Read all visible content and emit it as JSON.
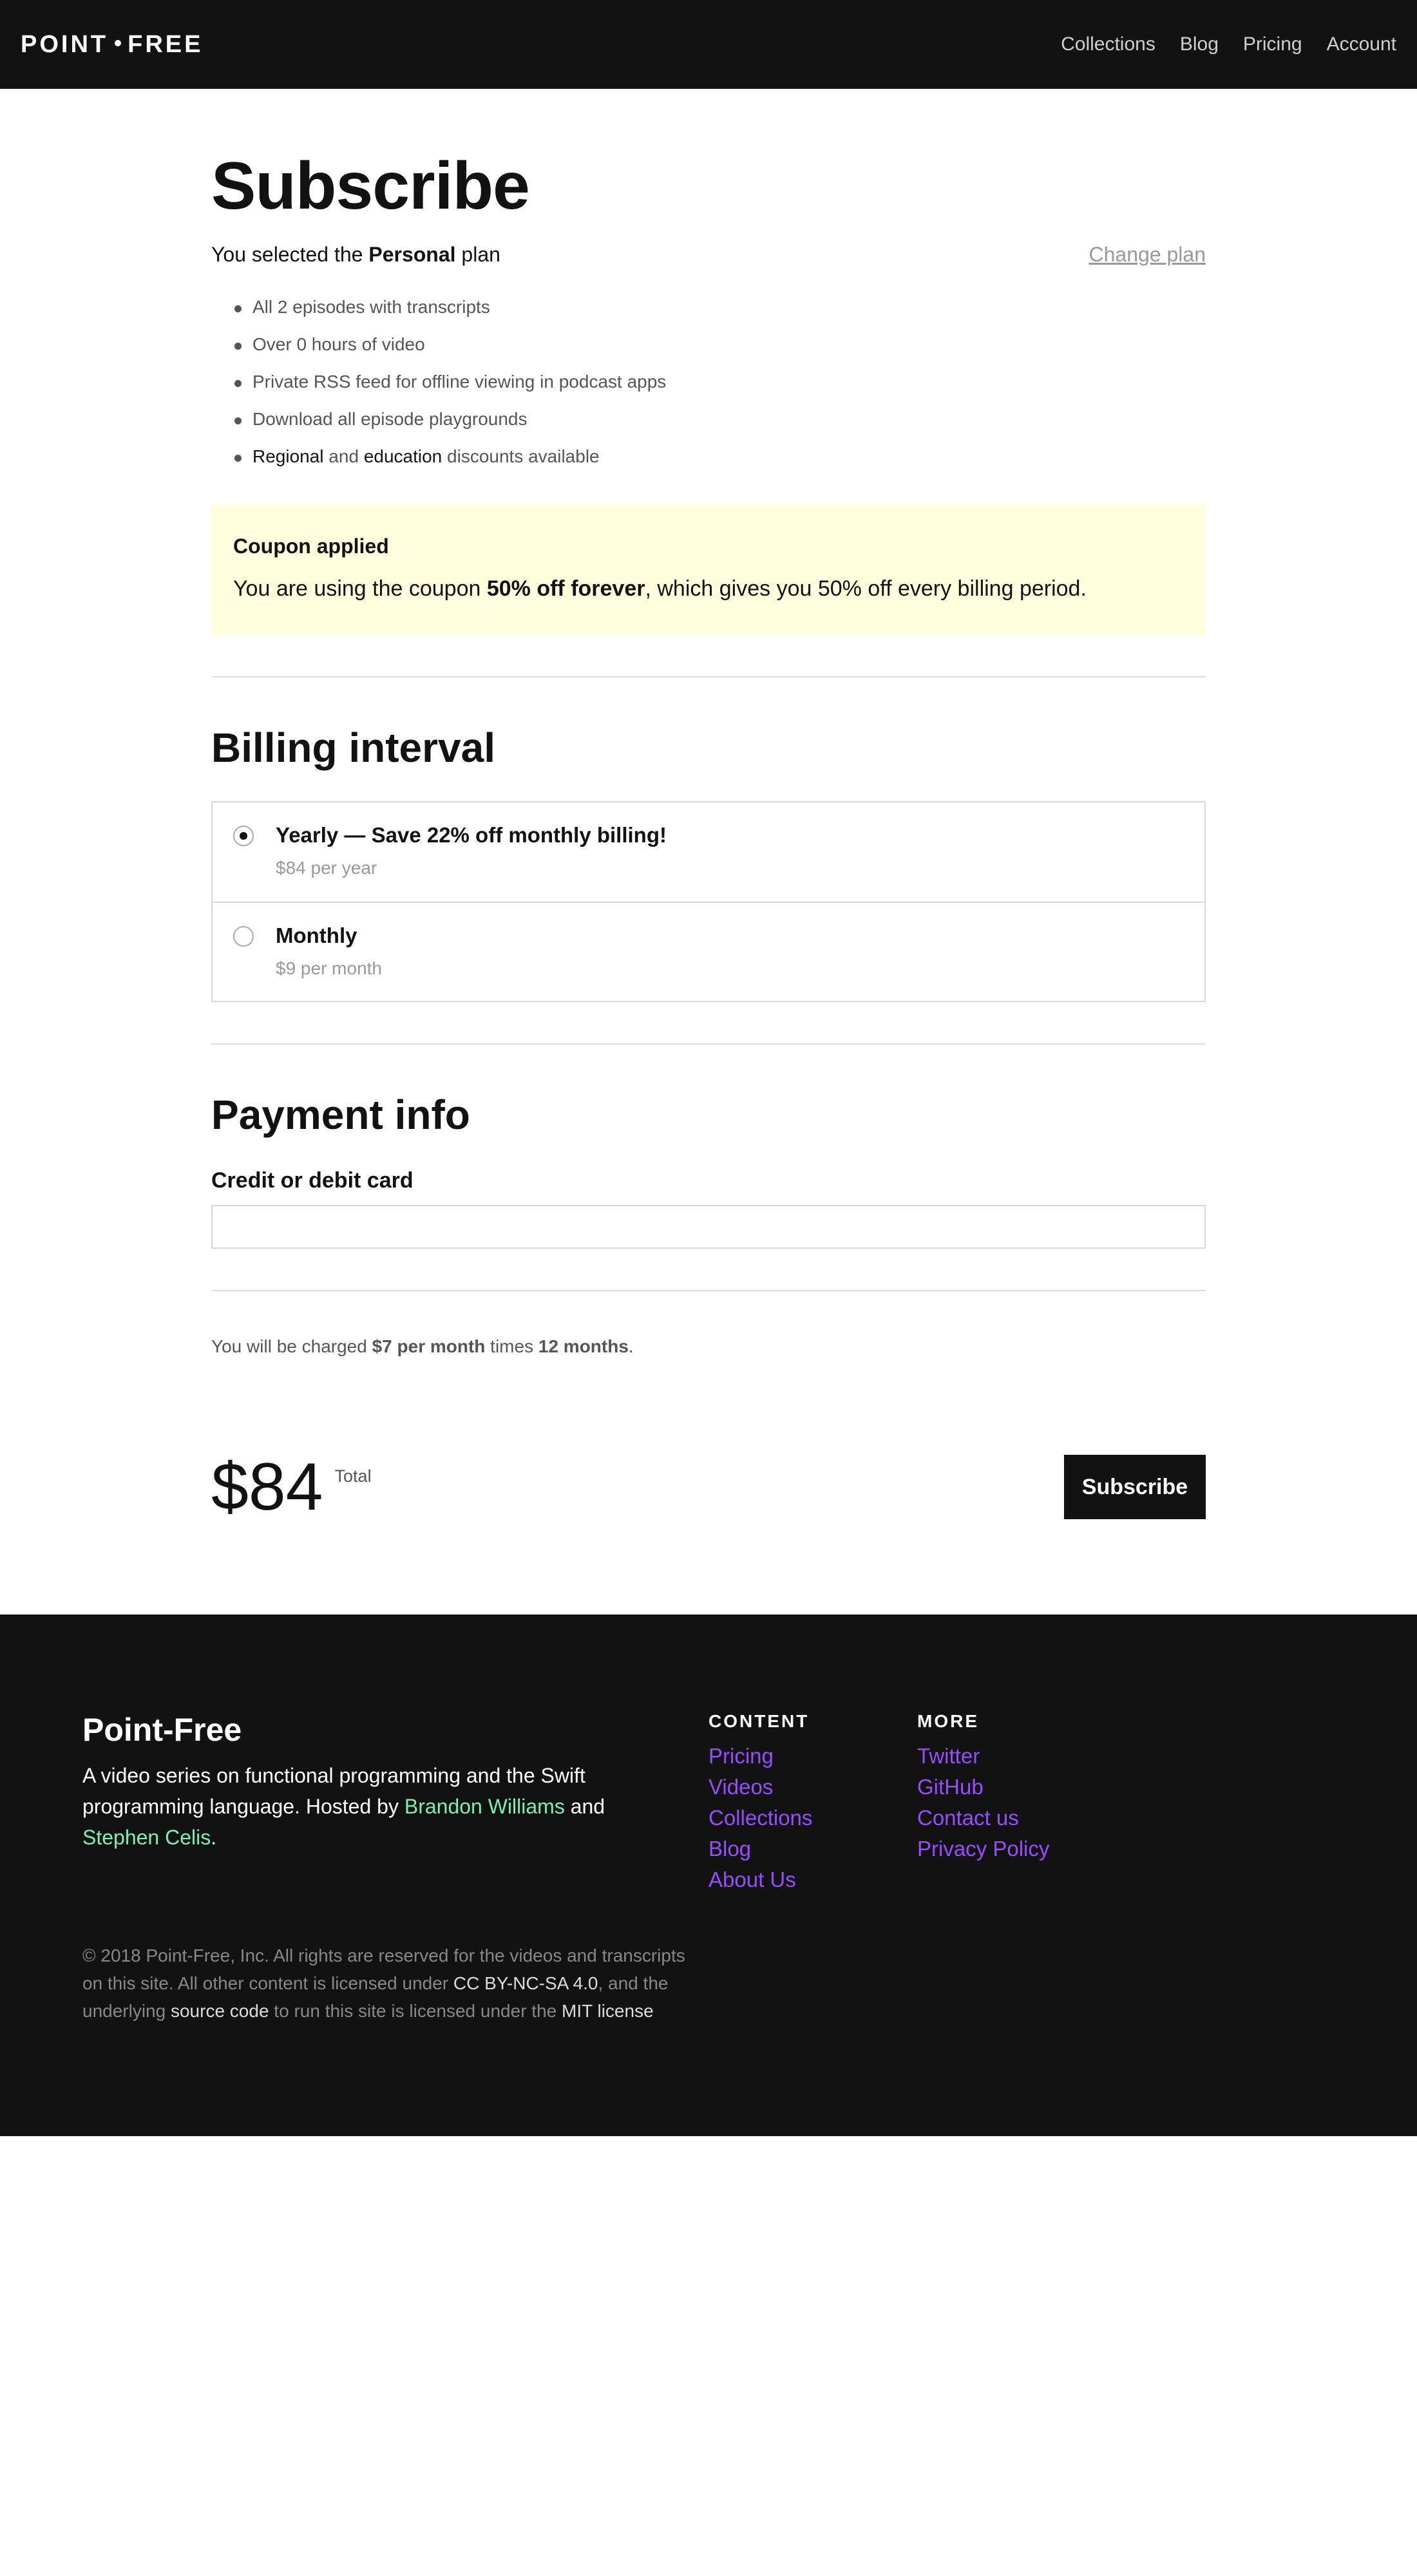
{
  "header": {
    "logo_left": "POINT",
    "logo_right": "FREE",
    "nav": [
      "Collections",
      "Blog",
      "Pricing",
      "Account"
    ]
  },
  "page": {
    "title": "Subscribe",
    "plan_prefix": "You selected the ",
    "plan_name": "Personal",
    "plan_suffix": " plan",
    "change_plan": "Change plan"
  },
  "features": [
    "All 2 episodes with transcripts",
    "Over 0 hours of video",
    "Private RSS feed for offline viewing in podcast apps",
    "Download all episode playgrounds"
  ],
  "discounts": {
    "regional": "Regional",
    "and": " and ",
    "education": "education",
    "suffix": " discounts available"
  },
  "coupon": {
    "title": "Coupon applied",
    "prefix": "You are using the coupon ",
    "name": "50% off forever",
    "suffix": ", which gives you 50% off every billing period."
  },
  "billing": {
    "heading": "Billing interval",
    "options": [
      {
        "title": "Yearly — Save 22% off monthly billing!",
        "sub": "$84 per year",
        "selected": true
      },
      {
        "title": "Monthly",
        "sub": "$9 per month",
        "selected": false
      }
    ]
  },
  "payment": {
    "heading": "Payment info",
    "card_label": "Credit or debit card",
    "card_value": ""
  },
  "charge": {
    "prefix": "You will be charged ",
    "amount": "$7 per month",
    "mid": " times ",
    "count": "12 months",
    "end": "."
  },
  "total": {
    "amount": "$84",
    "label": "Total",
    "button": "Subscribe"
  },
  "footer": {
    "brand": "Point-Free",
    "desc_prefix": "A video series on functional programming and the Swift programming language. Hosted by ",
    "host1": "Brandon Williams",
    "desc_and": " and ",
    "host2": "Stephen Celis",
    "desc_end": ".",
    "content_heading": "CONTENT",
    "content_links": [
      "Pricing",
      "Videos",
      "Collections",
      "Blog",
      "About Us"
    ],
    "more_heading": "MORE",
    "more_links": [
      "Twitter",
      "GitHub",
      "Contact us",
      "Privacy Policy"
    ],
    "copy1": "© 2018 Point-Free, Inc. All rights are reserved for the videos and transcripts on this site. All other content is licensed under ",
    "license1": "CC BY-NC-SA 4.0",
    "copy2": ", and the underlying ",
    "source": "source code",
    "copy3": " to run this site is licensed under the ",
    "license2": "MIT license"
  }
}
